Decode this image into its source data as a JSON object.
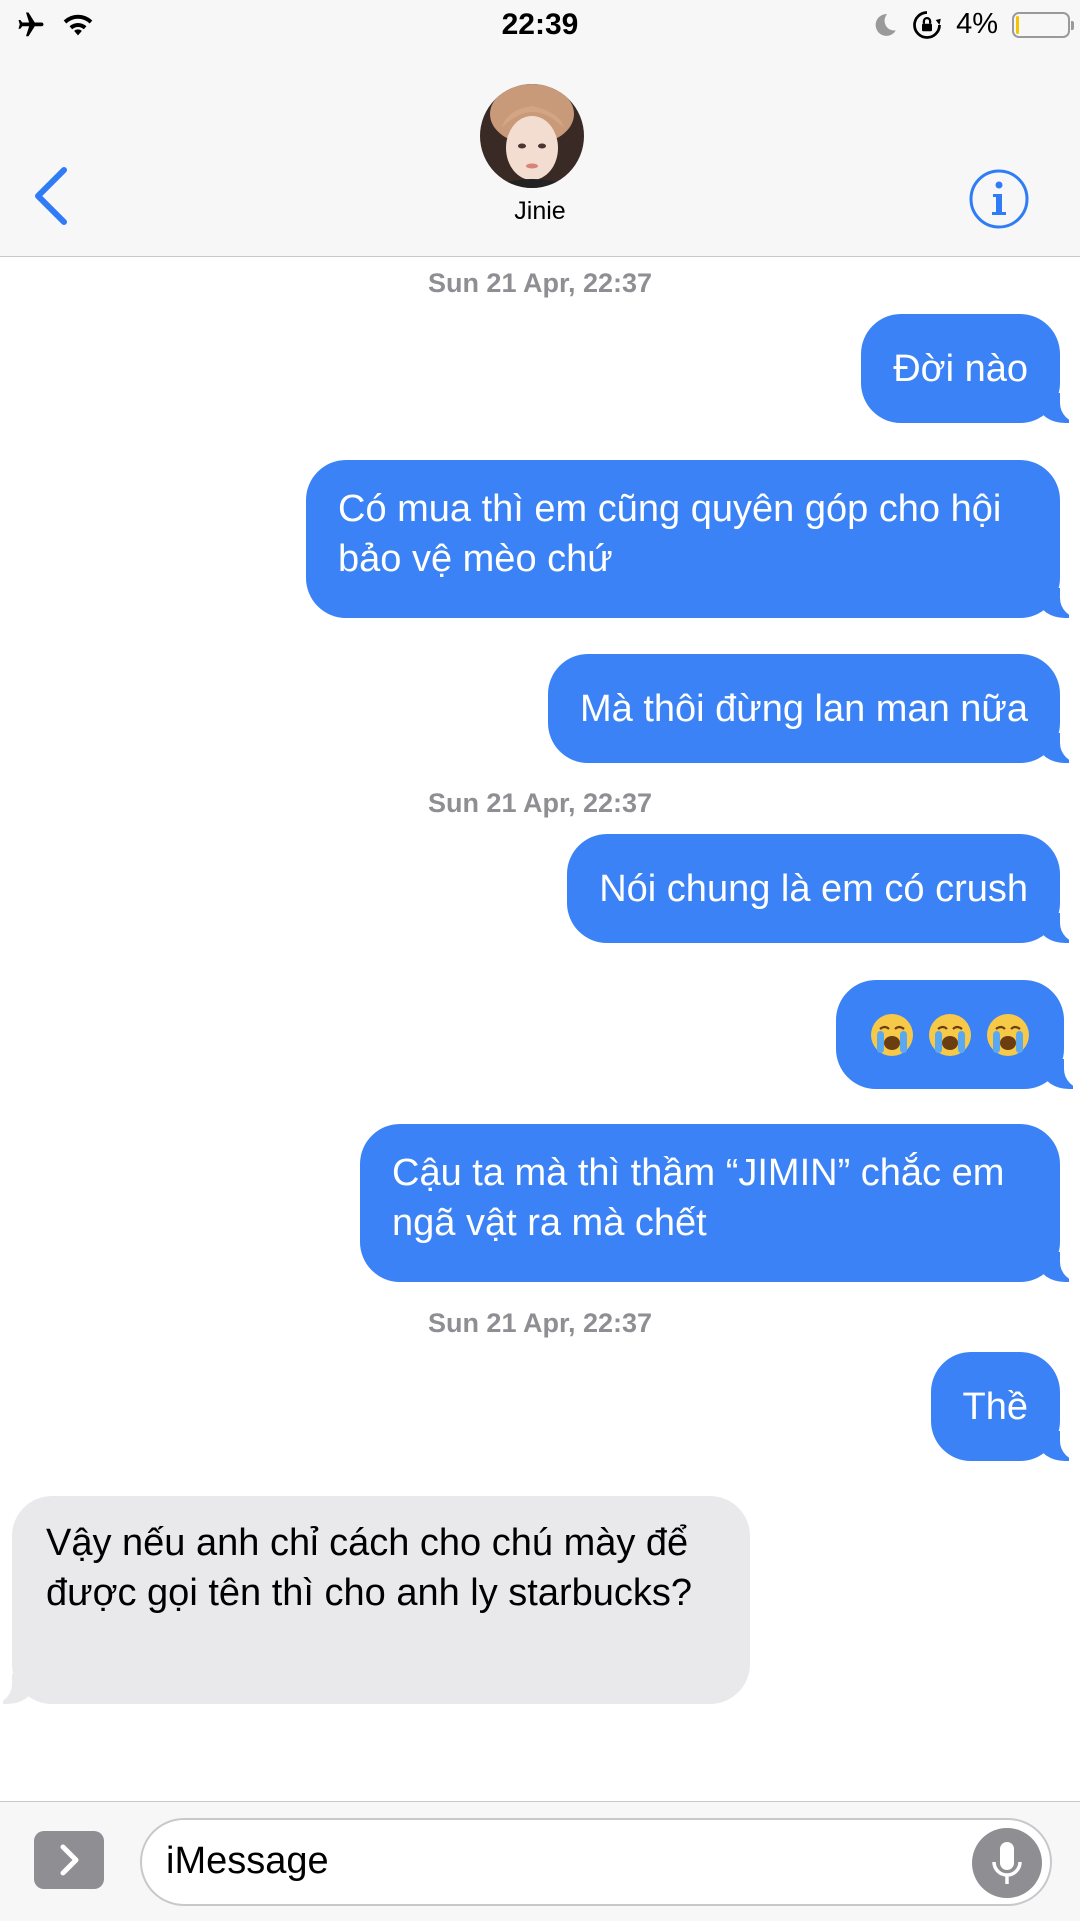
{
  "status_bar": {
    "time": "22:39",
    "battery_percent": "4%",
    "battery_level": 0.04,
    "icons": [
      "airplane-icon",
      "wifi-icon",
      "moon-icon",
      "orientation-lock-icon",
      "battery-icon"
    ]
  },
  "header": {
    "contact_name": "Jinie"
  },
  "conversation": {
    "timestamps": [
      "Sun 21 Apr, 22:37",
      "Sun 21 Apr, 22:37",
      "Sun 21 Apr, 22:37"
    ],
    "messages": [
      {
        "direction": "outgoing",
        "text": "Đời nào"
      },
      {
        "direction": "outgoing",
        "text": "Có mua thì em cũng quyên góp cho hội bảo vệ mèo chứ"
      },
      {
        "direction": "outgoing",
        "text": "Mà thôi đừng lan man nữa"
      },
      {
        "direction": "outgoing",
        "text": "Nói chung là em có crush"
      },
      {
        "direction": "outgoing",
        "text": "😭😭😭",
        "emoji": "loudly-crying-face"
      },
      {
        "direction": "outgoing",
        "text": "Cậu ta mà thì thầm “JIMIN” chắc em ngã vật ra mà chết"
      },
      {
        "direction": "outgoing",
        "text": "Thề"
      },
      {
        "direction": "incoming",
        "text": "Vậy nếu anh chỉ cách cho chú mày để được gọi tên thì cho anh ly starbucks?"
      }
    ]
  },
  "input_bar": {
    "placeholder": "iMessage"
  },
  "colors": {
    "outgoing_bubble": "#3b82f6",
    "incoming_bubble": "#e9e9eb",
    "accent": "#2f7cf6",
    "timestamp": "#8e8e93",
    "battery_low": "#f5c400"
  }
}
